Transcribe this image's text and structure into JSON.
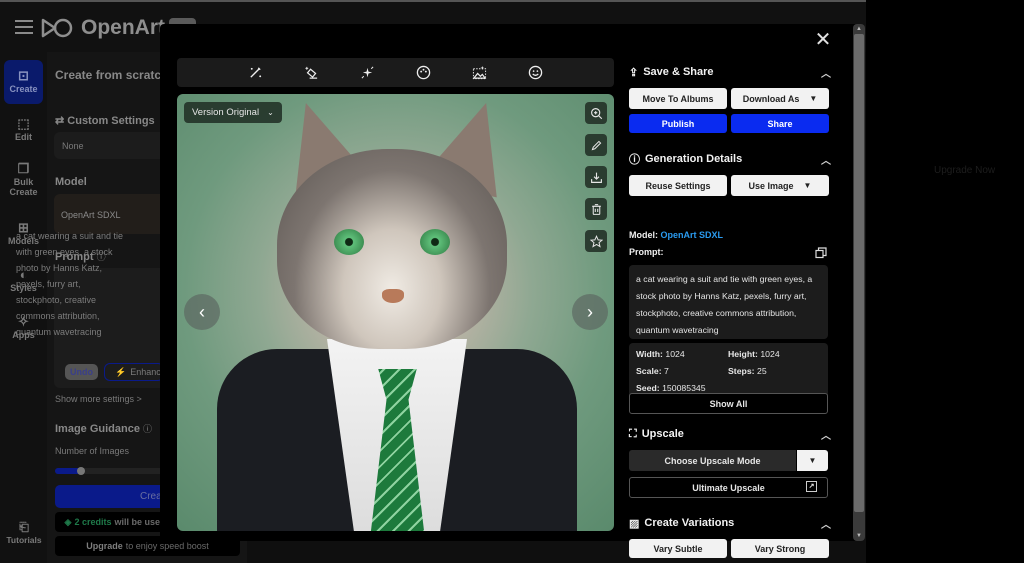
{
  "app": {
    "brand": "OpenArt",
    "nav": [
      {
        "label": "Create",
        "icon": "create-icon",
        "active": true
      },
      {
        "label": "Edit",
        "icon": "edit-icon"
      },
      {
        "label": "Bulk Create",
        "icon": "bulk-create-icon"
      },
      {
        "label": "Models",
        "icon": "models-icon"
      },
      {
        "label": "Styles",
        "icon": "palette-icon"
      },
      {
        "label": "Apps",
        "icon": "sparkles-icon"
      },
      {
        "label": "Tutorials",
        "icon": "book-icon"
      }
    ],
    "side_panel": {
      "title": "Create from scratch",
      "custom_settings_label": "Custom Settings",
      "custom_settings_value": "None",
      "model_label": "Model",
      "model_value": "OpenArt SDXL",
      "prompt_label": "Prompt",
      "prompt_text": "a cat wearing a suit and tie with green eyes, a stock photo by Hanns Katz, pexels, furry art, stockphoto, creative commons attribution, quantum wavetracing",
      "undo_label": "Undo",
      "enhance_label": "Enhance",
      "show_more": "Show more settings >",
      "image_guidance_label": "Image Guidance",
      "num_images_label": "Number of Images",
      "num_images_fraction": 0.2,
      "create_label": "Create",
      "credits_highlight": "2 credits",
      "credits_rest": "will be used",
      "upgrade_bold": "Upgrade",
      "upgrade_rest": "to enjoy speed boost"
    },
    "right_faint": {
      "upgrade_now": "Upgrade Now"
    }
  },
  "modal": {
    "toolbar": [
      {
        "name": "magic-wand-icon",
        "label": "Sketch to image"
      },
      {
        "name": "eraser-icon",
        "label": "Remove"
      },
      {
        "name": "enhance-sparkle-icon",
        "label": "Enhance"
      },
      {
        "name": "palette-icon",
        "label": "Style"
      },
      {
        "name": "image-expand-icon",
        "label": "Expand"
      },
      {
        "name": "face-icon",
        "label": "Face"
      }
    ],
    "version_selector": "Version Original",
    "image_actions": [
      "zoom-in-icon",
      "pencil-icon",
      "download-icon",
      "trash-icon",
      "star-icon"
    ],
    "save_share": {
      "title": "Save & Share",
      "move_to_albums": "Move To Albums",
      "download_as": "Download As",
      "publish": "Publish",
      "share": "Share"
    },
    "generation_details": {
      "title": "Generation Details",
      "reuse_settings": "Reuse Settings",
      "use_image": "Use Image",
      "model_label": "Model:",
      "model_value": "OpenArt SDXL",
      "prompt_label": "Prompt:",
      "prompt_text": "a cat wearing a suit and tie with green eyes, a stock photo by Hanns Katz, pexels, furry art, stockphoto, creative commons attribution, quantum wavetracing",
      "width_label": "Width:",
      "width_value": "1024",
      "height_label": "Height:",
      "height_value": "1024",
      "scale_label": "Scale:",
      "scale_value": "7",
      "steps_label": "Steps:",
      "steps_value": "25",
      "seed_label": "Seed:",
      "seed_value": "150085345",
      "show_all": "Show All"
    },
    "upscale": {
      "title": "Upscale",
      "choose_mode": "Choose Upscale Mode",
      "ultimate": "Ultimate Upscale"
    },
    "variations": {
      "title": "Create Variations",
      "vary_subtle": "Vary Subtle",
      "vary_strong": "Vary Strong"
    }
  },
  "colors": {
    "accent_blue": "#0a2bf0",
    "link_blue": "#2a9bf0",
    "credits_green": "#1f7a4a"
  }
}
